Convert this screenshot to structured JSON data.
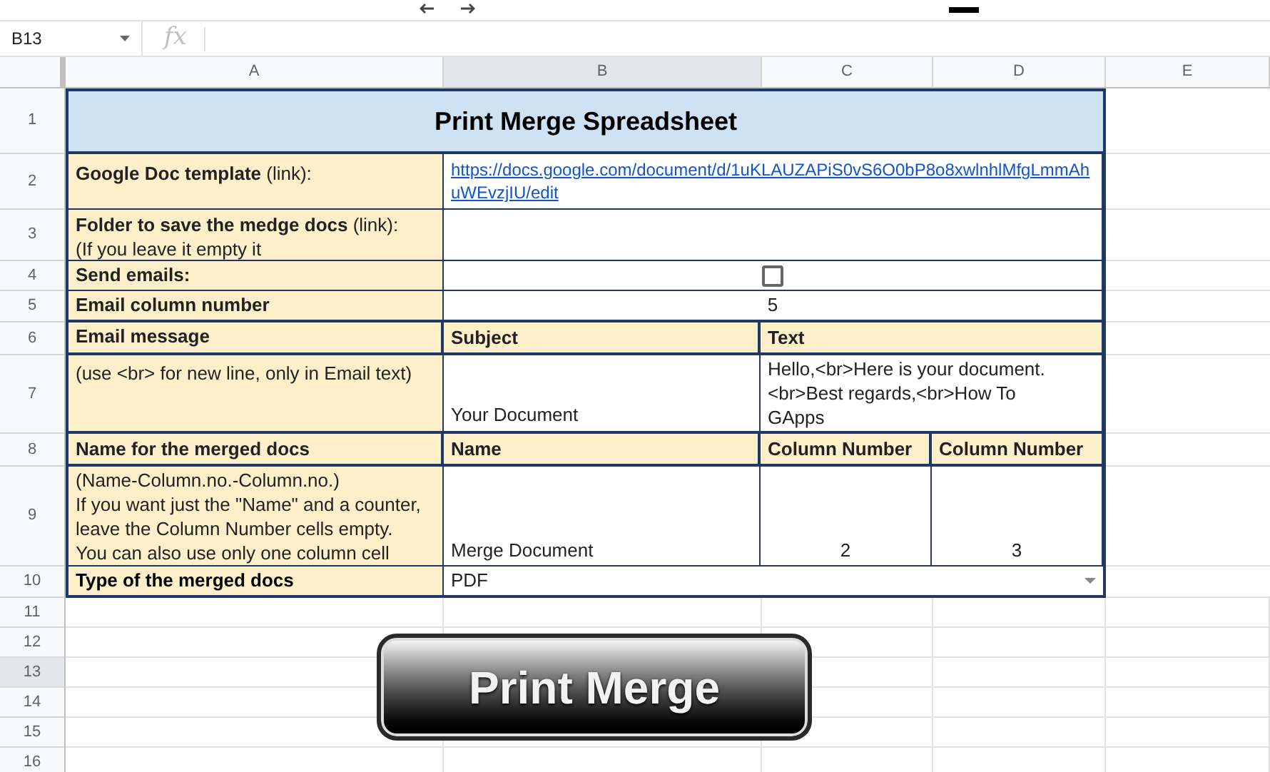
{
  "name_box": {
    "value": "B13"
  },
  "formula_bar": {
    "icon_text": "fx"
  },
  "column_headers": [
    {
      "label": "A",
      "selected": false
    },
    {
      "label": "B",
      "selected": true
    },
    {
      "label": "C",
      "selected": false
    },
    {
      "label": "D",
      "selected": false
    },
    {
      "label": "E",
      "selected": false
    }
  ],
  "row_headers": [
    {
      "label": "1",
      "selected": false
    },
    {
      "label": "2",
      "selected": false
    },
    {
      "label": "3",
      "selected": false
    },
    {
      "label": "4",
      "selected": false
    },
    {
      "label": "5",
      "selected": false
    },
    {
      "label": "6",
      "selected": false
    },
    {
      "label": "7",
      "selected": false
    },
    {
      "label": "8",
      "selected": false
    },
    {
      "label": "9",
      "selected": false
    },
    {
      "label": "10",
      "selected": false
    },
    {
      "label": "11",
      "selected": false
    },
    {
      "label": "12",
      "selected": false
    },
    {
      "label": "13",
      "selected": true
    },
    {
      "label": "14",
      "selected": false
    },
    {
      "label": "15",
      "selected": false
    },
    {
      "label": "16",
      "selected": false
    }
  ],
  "sheet": {
    "title": "Print Merge Spreadsheet",
    "template": {
      "label": "**Google Doc template** (link):",
      "url": "https://docs.google.com/document/d/1uKLAUZAPiS0vS6O0bP8o8xwlnhlMfgLmmAhuWEvzjIU/edit"
    },
    "folder": {
      "label": "**Folder to save the medge docs** (link):\n(If you leave it empty it"
    },
    "send_emails": {
      "label": "Send emails:",
      "checked": false
    },
    "email_column": {
      "label": "Email column number",
      "value": "5"
    },
    "email_message": {
      "label": "Email message",
      "hint": "(use <br> for new line, only in Email text)",
      "subject_header": "Subject",
      "subject": "Your Document",
      "text_header": "Text",
      "text": "Hello,<br>Here is your document.<br>Best regards,<br>How To GApps"
    },
    "merged_name": {
      "label": "Name for the merged docs",
      "hint": "(Name-Column.no.-Column.no.)\nIf you want just the \"Name\" and a counter,\nleave the Column Number cells empty.\nYou can also use only one column cell",
      "name_header": "Name",
      "name": "Merge Document",
      "column_headers": [
        "Column Number",
        "Column Number"
      ],
      "columns": [
        "2",
        "3"
      ]
    },
    "doc_type": {
      "label": "Type of the merged docs",
      "value": "PDF"
    }
  },
  "print_button": {
    "label": "Print Merge"
  }
}
